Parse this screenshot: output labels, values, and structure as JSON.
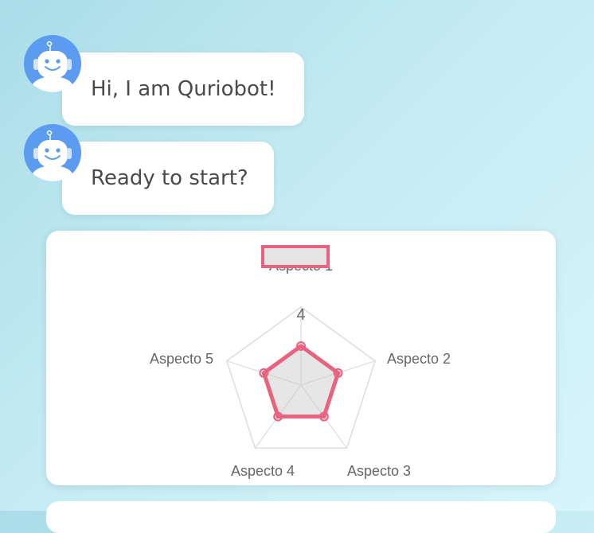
{
  "messages": [
    {
      "text": "Hi, I am Quriobot!",
      "avatar_icon": "robot-icon"
    },
    {
      "text": "Ready to start?",
      "avatar_icon": "robot-icon"
    }
  ],
  "colors": {
    "avatar": "#5b9cf0",
    "series": "#e8637f",
    "series_fill": "rgba(200,200,200,0.45)",
    "grid": "#dddddd"
  },
  "chart_data": {
    "type": "radar",
    "categories": [
      "Aspecto 1",
      "Aspecto 2",
      "Aspecto 3",
      "Aspecto 4",
      "Aspecto 5"
    ],
    "series": [
      {
        "name": "",
        "values": [
          2,
          2,
          2,
          2,
          2
        ]
      }
    ],
    "tick_labels": [
      "4"
    ],
    "range": [
      0,
      4
    ],
    "legend": "top"
  }
}
